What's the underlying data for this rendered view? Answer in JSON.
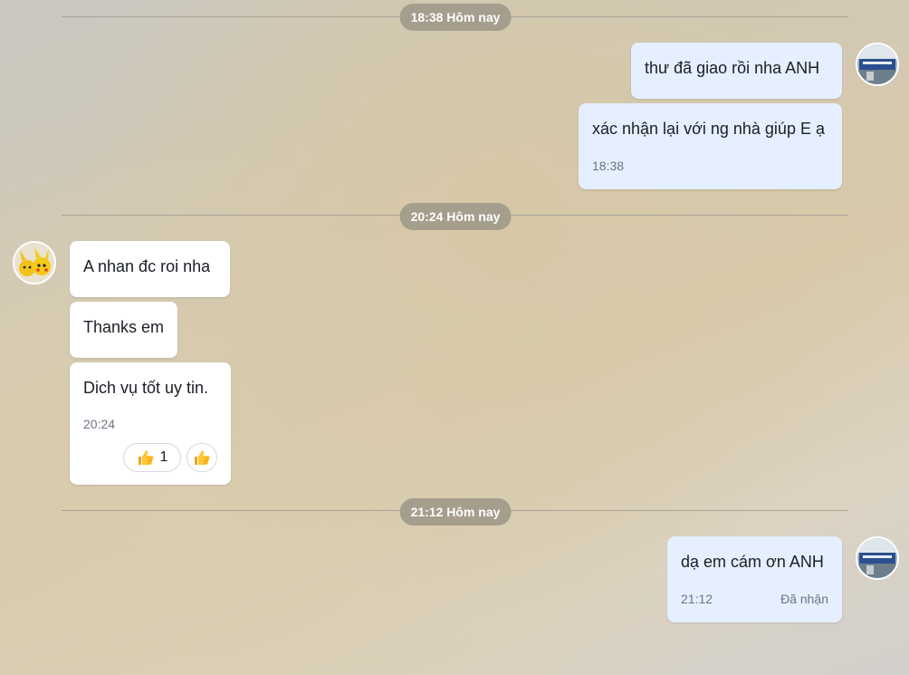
{
  "dividers": [
    {
      "label": "18:38 Hôm nay"
    },
    {
      "label": "20:24 Hôm nay"
    },
    {
      "label": "21:12 Hôm nay"
    }
  ],
  "messages": {
    "m1": {
      "text": "thư đã giao rồi nha ANH"
    },
    "m2": {
      "text": "xác nhận lại với ng nhà giúp E ạ",
      "time": "18:38"
    },
    "m3": {
      "text": "A nhan đc roi nha"
    },
    "m4": {
      "text": "Thanks em"
    },
    "m5": {
      "text": "Dich vụ tốt uy tin.",
      "time": "20:24",
      "reaction_icon": "thumbs-up-icon",
      "reaction_count": "1"
    },
    "m6": {
      "text": "dạ em cám ơn ANH",
      "time": "21:12",
      "status": "Đã nhận"
    }
  },
  "colors": {
    "outgoing_bubble": "#e5efff",
    "incoming_bubble": "#ffffff",
    "time_pill": "#a59e8d"
  }
}
